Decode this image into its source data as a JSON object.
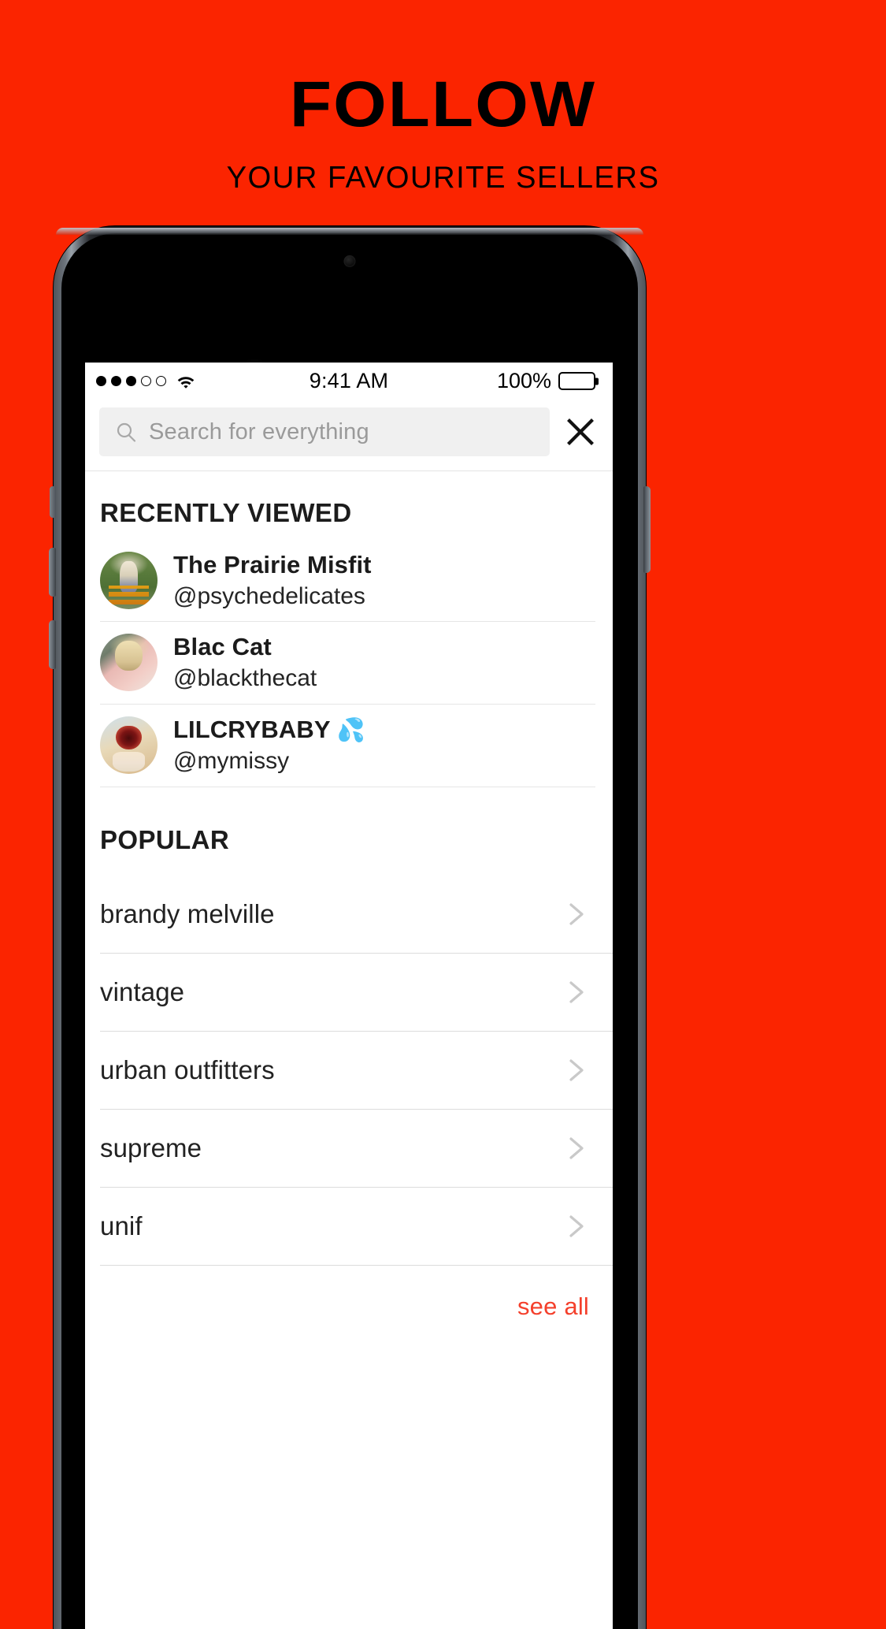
{
  "promo": {
    "title": "FOLLOW",
    "subtitle": "YOUR FAVOURITE SELLERS",
    "background_color": "#FB2400"
  },
  "status_bar": {
    "signal_dots_filled": 3,
    "signal_dots_empty": 2,
    "wifi_icon": "wifi-icon",
    "time": "9:41 AM",
    "battery_percent": "100%",
    "battery_icon": "battery-full-icon"
  },
  "search": {
    "icon": "search-icon",
    "placeholder": "Search for everything",
    "value": "",
    "close_icon": "close-icon"
  },
  "recently_viewed": {
    "heading": "RECENTLY VIEWED",
    "sellers": [
      {
        "name": "The Prairie Misfit",
        "handle": "@psychedelicates",
        "avatar": "avatar-prairie-misfit"
      },
      {
        "name": "Blac Cat",
        "handle": "@blackthecat",
        "avatar": "avatar-blac-cat"
      },
      {
        "name": "LILCRYBABY",
        "name_emoji": "💦",
        "handle": "@mymissy",
        "avatar": "avatar-lilcrybaby"
      }
    ]
  },
  "popular": {
    "heading": "POPULAR",
    "items": [
      {
        "label": "brandy melville",
        "chevron": "chevron-right-icon"
      },
      {
        "label": "vintage",
        "chevron": "chevron-right-icon"
      },
      {
        "label": "urban outfitters",
        "chevron": "chevron-right-icon"
      },
      {
        "label": "supreme",
        "chevron": "chevron-right-icon"
      },
      {
        "label": "unif",
        "chevron": "chevron-right-icon"
      }
    ],
    "see_all_label": "see all",
    "see_all_color": "#F4402C"
  }
}
